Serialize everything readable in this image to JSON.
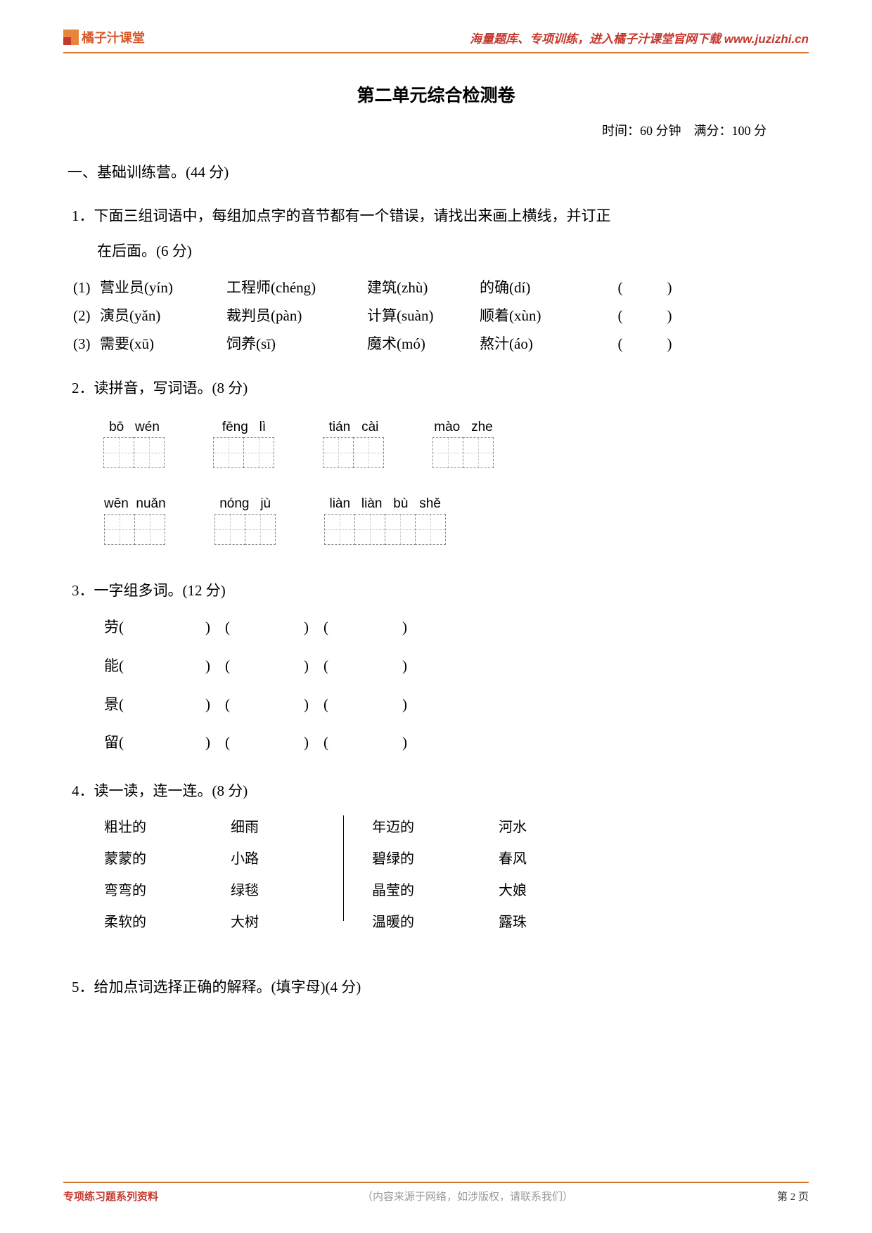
{
  "header": {
    "logo_text": "橘子汁课堂",
    "link_text": "海量题库、专项训练，进入橘子汁课堂官网下载 www.juzizhi.cn"
  },
  "title": "第二单元综合检测卷",
  "meta": "时间：60 分钟　满分：100 分",
  "section1": "一、基础训练营。(44 分)",
  "q1": {
    "stem": "1．下面三组词语中，每组加点字的音节都有一个错误，请找出来画上横线，并订正",
    "stem2": "在后面。(6 分)",
    "rows": [
      {
        "label": "(1)",
        "c1": "营业员(yín)",
        "c2": "工程师(chéng)",
        "c3": "建筑(zhù)",
        "c4": "的确(dí)",
        "ans": "(　　　)"
      },
      {
        "label": "(2)",
        "c1": "演员(yǎn)",
        "c2": "裁判员(pàn)",
        "c3": "计算(suàn)",
        "c4": "顺着(xùn)",
        "ans": "(　　　)"
      },
      {
        "label": "(3)",
        "c1": "需要(xū)",
        "c2": "饲养(sī)",
        "c3": "魔术(mó)",
        "c4": "熬汁(áo)",
        "ans": "(　　　)"
      }
    ]
  },
  "q2": {
    "stem": "2．读拼音，写词语。(8 分)",
    "row1": [
      {
        "pinyin": "bō   wén",
        "boxes": 2
      },
      {
        "pinyin": "fēng   lì",
        "boxes": 2
      },
      {
        "pinyin": "tián   cài",
        "boxes": 2
      },
      {
        "pinyin": "mào   zhe",
        "boxes": 2
      }
    ],
    "row2": [
      {
        "pinyin": "wēn  nuǎn",
        "boxes": 2
      },
      {
        "pinyin": "nóng   jù",
        "boxes": 2
      },
      {
        "pinyin": "liàn   liàn   bù   shě",
        "boxes": 4
      }
    ]
  },
  "q3": {
    "stem": "3．一字组多词。(12 分)",
    "chars": [
      "劳",
      "能",
      "景",
      "留"
    ]
  },
  "q4": {
    "stem": "4．读一读，连一连。(8 分)",
    "leftA": [
      "粗壮的",
      "蒙蒙的",
      "弯弯的",
      "柔软的"
    ],
    "leftB": [
      "细雨",
      "小路",
      "绿毯",
      "大树"
    ],
    "rightA": [
      "年迈的",
      "碧绿的",
      "晶莹的",
      "温暖的"
    ],
    "rightB": [
      "河水",
      "春风",
      "大娘",
      "露珠"
    ]
  },
  "q5": {
    "stem": "5．给加点词选择正确的解释。(填字母)(4 分)"
  },
  "footer": {
    "left": "专项练习题系列资料",
    "mid": "（内容来源于网络，如涉版权，请联系我们）",
    "right": "第 2 页"
  }
}
